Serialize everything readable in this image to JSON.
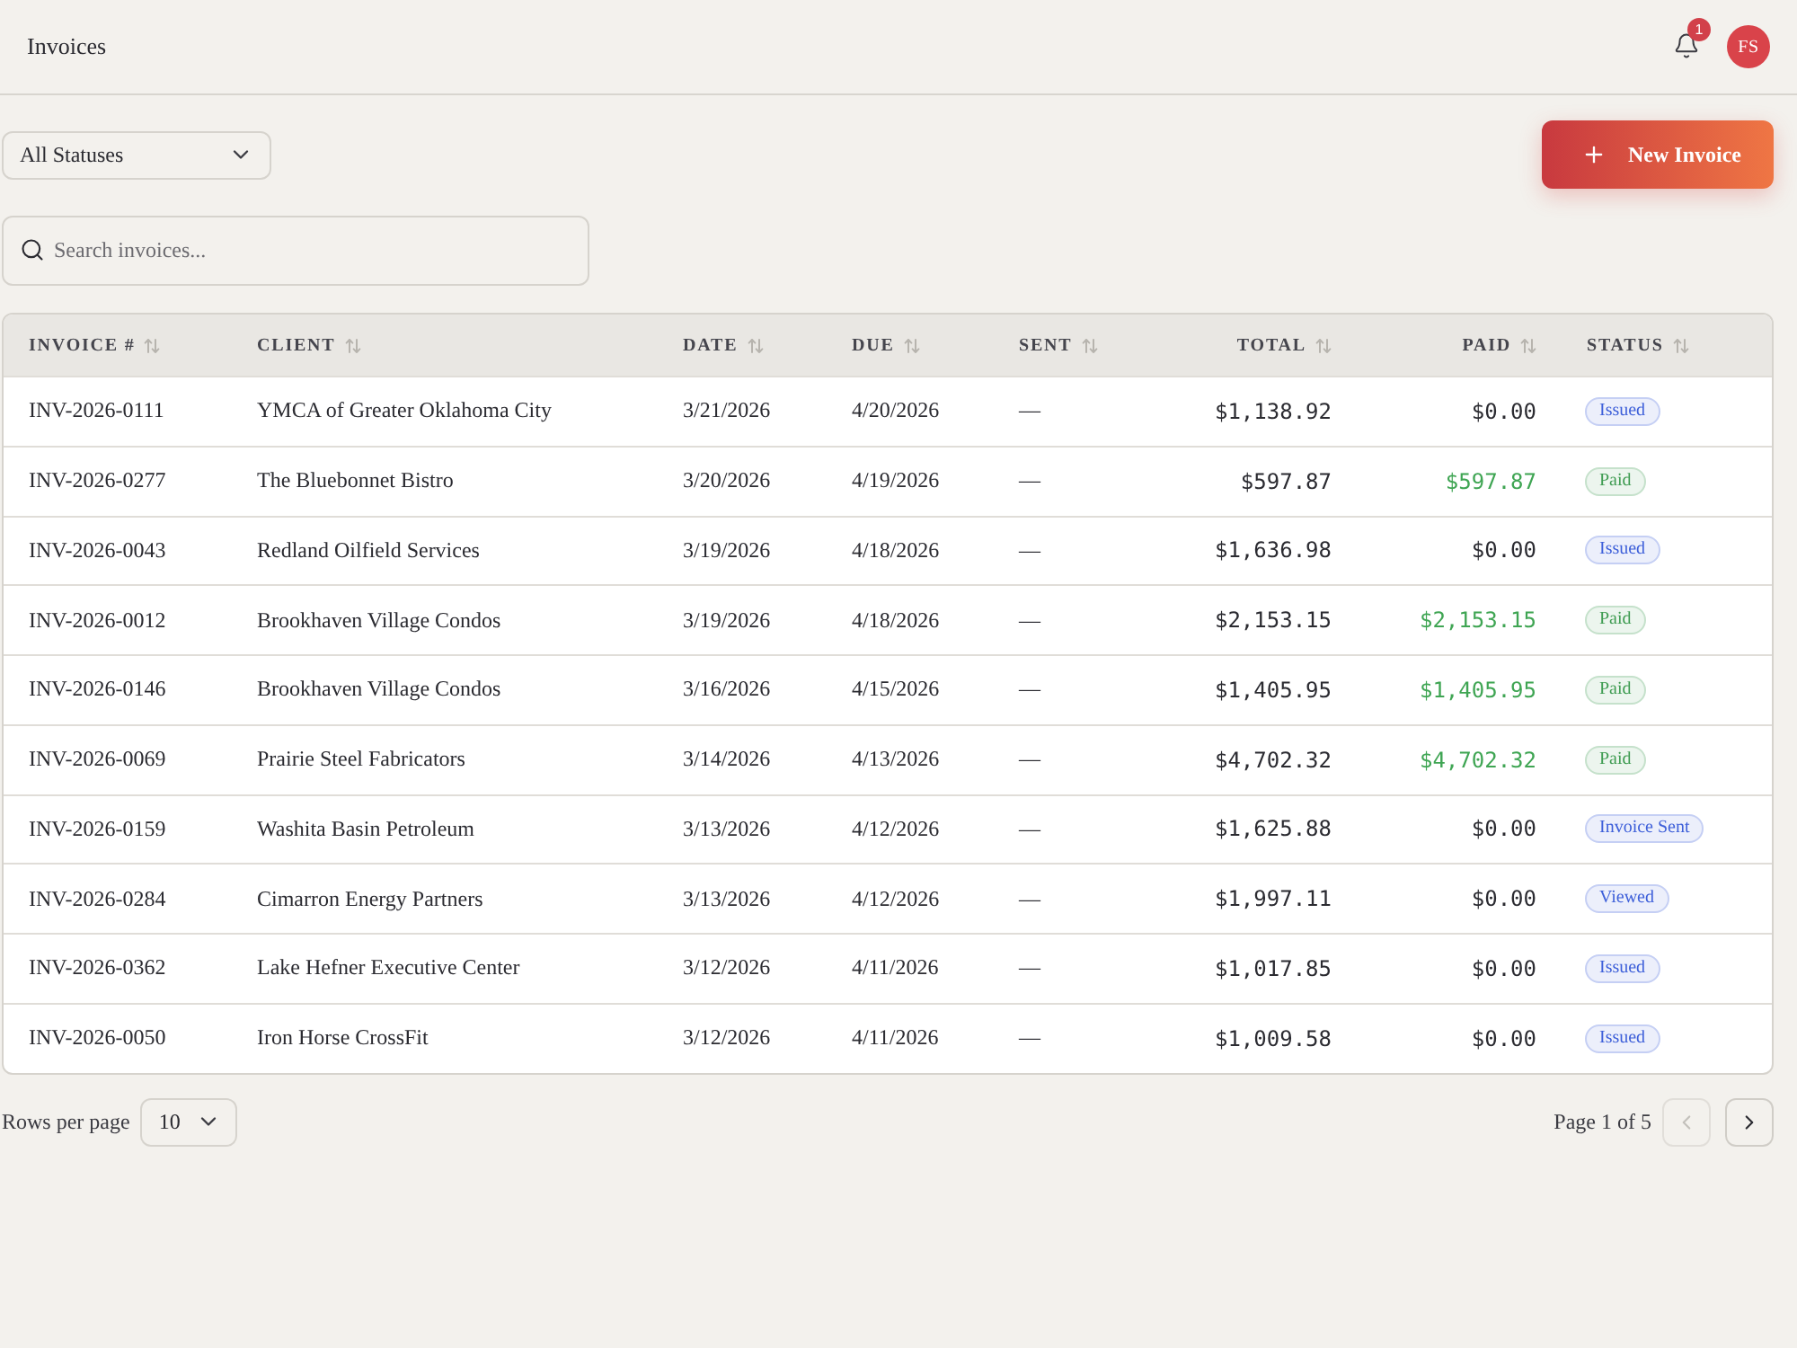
{
  "header": {
    "title": "Invoices",
    "notification_count": "1",
    "avatar_initials": "FS"
  },
  "toolbar": {
    "status_filter": {
      "value": "All Statuses"
    },
    "new_button": {
      "label": "New Invoice"
    }
  },
  "search": {
    "placeholder": "Search invoices..."
  },
  "table": {
    "columns": [
      {
        "label": "INVOICE #",
        "kind": "text"
      },
      {
        "label": "CLIENT",
        "kind": "text"
      },
      {
        "label": "DATE",
        "kind": "text"
      },
      {
        "label": "DUE",
        "kind": "text"
      },
      {
        "label": "SENT",
        "kind": "text"
      },
      {
        "label": "TOTAL",
        "kind": "amount"
      },
      {
        "label": "PAID",
        "kind": "amount"
      },
      {
        "label": "STATUS",
        "kind": "text"
      }
    ],
    "rows": [
      {
        "invoice": "INV-2026-0111",
        "client": "YMCA of Greater Oklahoma City",
        "date": "3/21/2026",
        "due": "4/20/2026",
        "sent": "—",
        "total": "$1,138.92",
        "paid": "$0.00",
        "paid_highlight": false,
        "status": {
          "label": "Issued",
          "color": "#3d5fd9"
        }
      },
      {
        "invoice": "INV-2026-0277",
        "client": "The Bluebonnet Bistro",
        "date": "3/20/2026",
        "due": "4/19/2026",
        "sent": "—",
        "total": "$597.87",
        "paid": "$597.87",
        "paid_highlight": true,
        "status": {
          "label": "Paid",
          "color": "#3f9c52"
        }
      },
      {
        "invoice": "INV-2026-0043",
        "client": "Redland Oilfield Services",
        "date": "3/19/2026",
        "due": "4/18/2026",
        "sent": "—",
        "total": "$1,636.98",
        "paid": "$0.00",
        "paid_highlight": false,
        "status": {
          "label": "Issued",
          "color": "#3d5fd9"
        }
      },
      {
        "invoice": "INV-2026-0012",
        "client": "Brookhaven Village Condos",
        "date": "3/19/2026",
        "due": "4/18/2026",
        "sent": "—",
        "total": "$2,153.15",
        "paid": "$2,153.15",
        "paid_highlight": true,
        "status": {
          "label": "Paid",
          "color": "#3f9c52"
        }
      },
      {
        "invoice": "INV-2026-0146",
        "client": "Brookhaven Village Condos",
        "date": "3/16/2026",
        "due": "4/15/2026",
        "sent": "—",
        "total": "$1,405.95",
        "paid": "$1,405.95",
        "paid_highlight": true,
        "status": {
          "label": "Paid",
          "color": "#3f9c52"
        }
      },
      {
        "invoice": "INV-2026-0069",
        "client": "Prairie Steel Fabricators",
        "date": "3/14/2026",
        "due": "4/13/2026",
        "sent": "—",
        "total": "$4,702.32",
        "paid": "$4,702.32",
        "paid_highlight": true,
        "status": {
          "label": "Paid",
          "color": "#3f9c52"
        }
      },
      {
        "invoice": "INV-2026-0159",
        "client": "Washita Basin Petroleum",
        "date": "3/13/2026",
        "due": "4/12/2026",
        "sent": "—",
        "total": "$1,625.88",
        "paid": "$0.00",
        "paid_highlight": false,
        "status": {
          "label": "Invoice Sent",
          "color": "#3d5fd9"
        }
      },
      {
        "invoice": "INV-2026-0284",
        "client": "Cimarron Energy Partners",
        "date": "3/13/2026",
        "due": "4/12/2026",
        "sent": "—",
        "total": "$1,997.11",
        "paid": "$0.00",
        "paid_highlight": false,
        "status": {
          "label": "Viewed",
          "color": "#3d5fd9"
        }
      },
      {
        "invoice": "INV-2026-0362",
        "client": "Lake Hefner Executive Center",
        "date": "3/12/2026",
        "due": "4/11/2026",
        "sent": "—",
        "total": "$1,017.85",
        "paid": "$0.00",
        "paid_highlight": false,
        "status": {
          "label": "Issued",
          "color": "#3d5fd9"
        }
      },
      {
        "invoice": "INV-2026-0050",
        "client": "Iron Horse CrossFit",
        "date": "3/12/2026",
        "due": "4/11/2026",
        "sent": "—",
        "total": "$1,009.58",
        "paid": "$0.00",
        "paid_highlight": false,
        "status": {
          "label": "Issued",
          "color": "#3d5fd9"
        }
      }
    ]
  },
  "footer": {
    "rows_per_page_label": "Rows per page",
    "rows_per_page": "10",
    "page_label": "Page 1 of 5",
    "previous_disabled": true,
    "next_disabled": false
  }
}
